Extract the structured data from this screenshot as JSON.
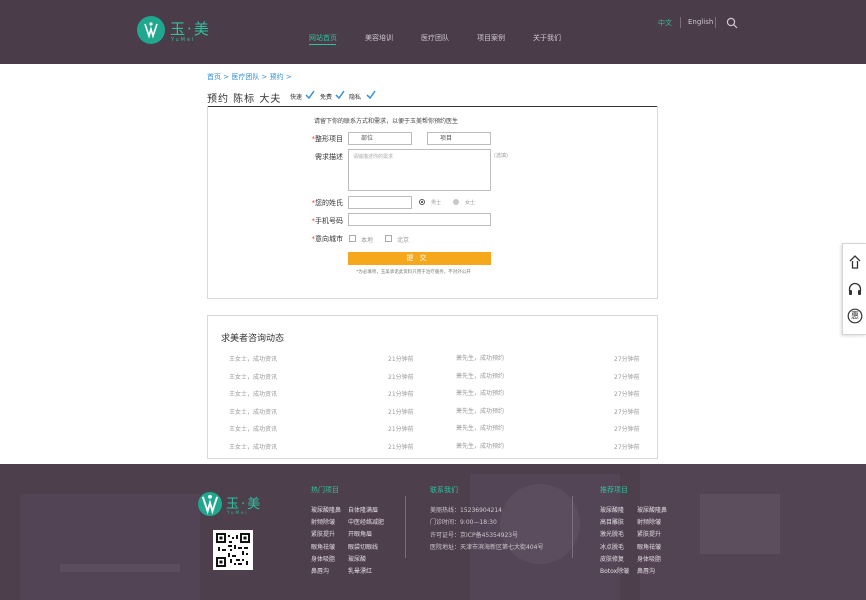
{
  "brand": {
    "name": "玉·美",
    "sub": "YuMei",
    "accent": "#2fc0a0",
    "header_bg": "#4a3c49"
  },
  "nav": {
    "items": [
      "网站首页",
      "美容培训",
      "医疗团队",
      "项目案例",
      "关于我们"
    ],
    "active": 0
  },
  "lang": {
    "cn": "中文",
    "en": "English"
  },
  "breadcrumb": "首页 > 医疗团队 > 预约 >",
  "page_title": "预约 陈标 大夫",
  "perks": [
    "快速",
    "免费",
    "隐私"
  ],
  "form": {
    "intro": "请留下你的联系方式和需求，以便于玉美帮你预约医生",
    "project_label": "整形项目",
    "part_value": "部位",
    "item_value": "项目",
    "need_label": "需求描述",
    "need_placeholder": "请输描述你的需求",
    "need_hint": "(选填)",
    "name_label": "您的姓氏",
    "gender_male": "男士",
    "gender_female": "女士",
    "phone_label": "手机号码",
    "city_label": "意向城市",
    "city_opt1": "本地",
    "city_opt2": "北京",
    "submit": "提交",
    "privacy": "*为必填项，玉美承诺此资料只用于治疗服务，不对外公开",
    "submit_color": "#f5a81c"
  },
  "feed": {
    "title": "求美者咨询动态",
    "rows": [
      {
        "left_name": "王女士，成功资讯",
        "left_time": "21分钟前",
        "right_name": "萧先生，成功预约",
        "right_time": "27分钟前"
      },
      {
        "left_name": "王女士，成功资讯",
        "left_time": "21分钟前",
        "right_name": "萧先生，成功预约",
        "right_time": "27分钟前"
      },
      {
        "left_name": "王女士，成功资讯",
        "left_time": "21分钟前",
        "right_name": "萧先生，成功预约",
        "right_time": "27分钟前"
      },
      {
        "left_name": "王女士，成功资讯",
        "left_time": "21分钟前",
        "right_name": "萧先生，成功预约",
        "right_time": "27分钟前"
      },
      {
        "left_name": "王女士，成功资讯",
        "left_time": "21分钟前",
        "right_name": "萧先生，成功预约",
        "right_time": "27分钟前"
      },
      {
        "left_name": "王女士，成功资讯",
        "left_time": "21分钟前",
        "right_name": "萧先生，成功预约",
        "right_time": "27分钟前"
      }
    ]
  },
  "side": {
    "icons": [
      "top-icon",
      "headset-icon",
      "discount-icon"
    ],
    "discount_char": "惠"
  },
  "footer": {
    "hot_title": "热门项目",
    "hot_col1": [
      "玻尿酸隆鼻",
      "射频除皱",
      "紧肤提升",
      "眼角祛皱",
      "身体吸脂",
      "鼻唇沟"
    ],
    "hot_col2": [
      "自体隆满眉",
      "中医经络减肥",
      "开眼角眉",
      "眼袋切眼线",
      "玻尿酸",
      "乳晕漂红"
    ],
    "contact_title": "联系我们",
    "contact": [
      "美丽热线：15236904214",
      "门诊时间：9:00—18:30",
      "许可证号：京ICP备45354923号",
      "医院地址：天津市滨海新区第七大街404号"
    ],
    "rec_title": "推荐项目",
    "rec_col1": [
      "玻尿酸隆",
      "高目雕肤",
      "激光脱毛",
      "冰点脱毛",
      "皮肤修复",
      "Botox除皱"
    ],
    "rec_col2": [
      "玻尿酸隆鼻",
      "射频除皱",
      "紧肤提升",
      "眼角祛皱",
      "身体吸脂",
      "鼻唇沟"
    ]
  }
}
